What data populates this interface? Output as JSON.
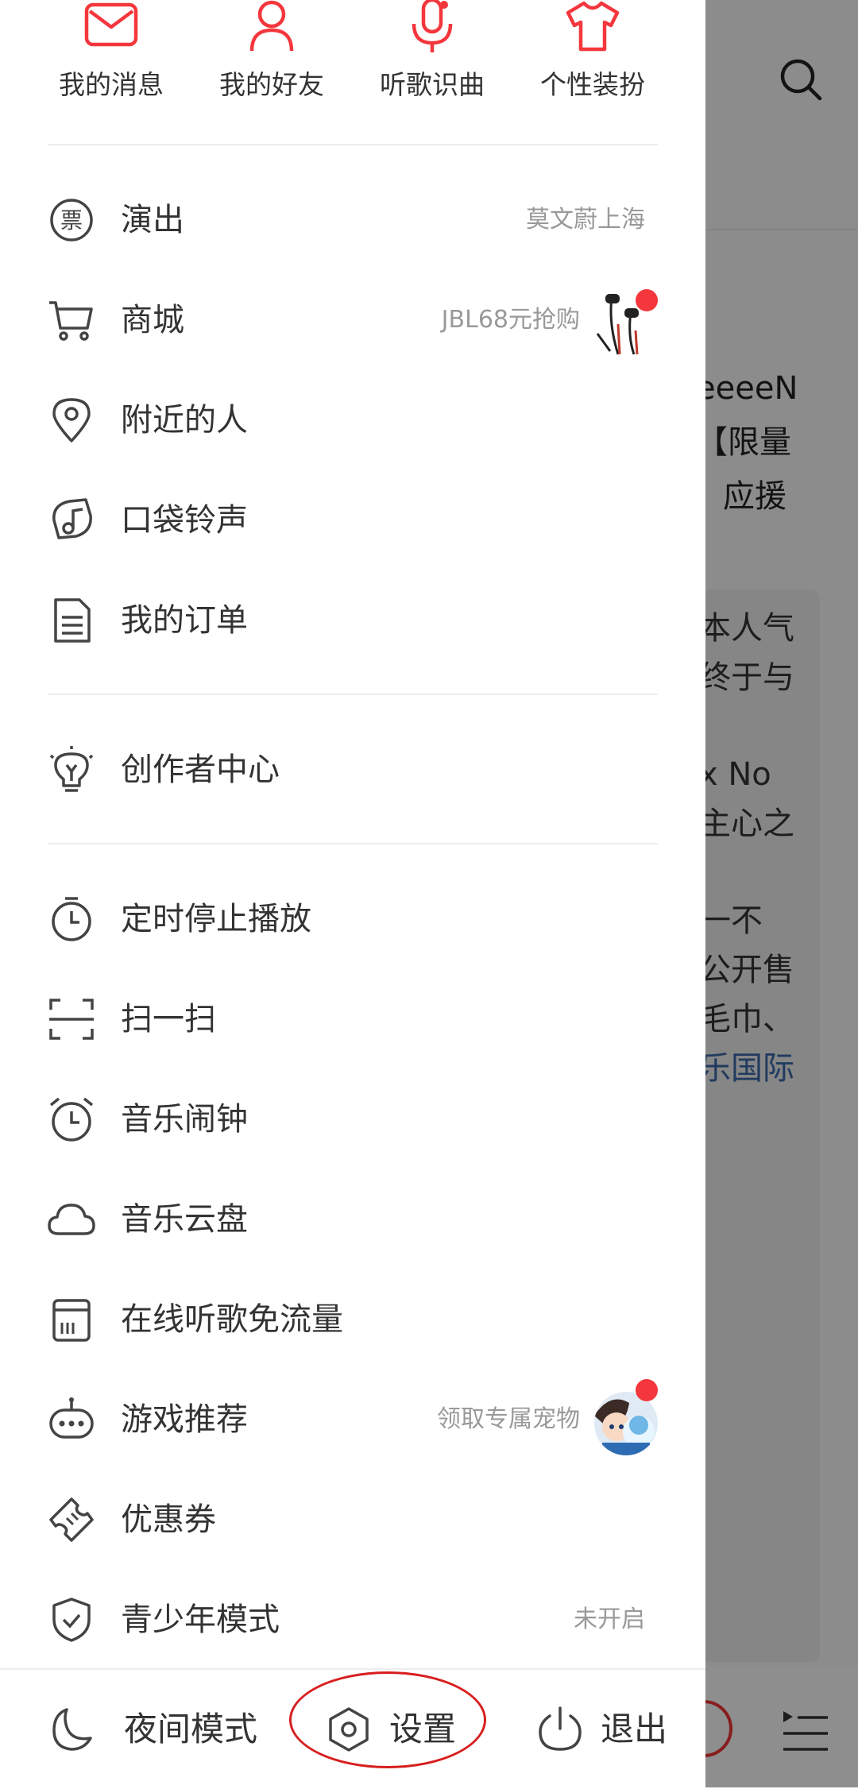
{
  "colors": {
    "accent": "#f4373d",
    "icon": "#444444",
    "text": "#333333",
    "subtext": "#999999"
  },
  "quick_actions": [
    {
      "label": "我的消息",
      "icon": "mail-icon"
    },
    {
      "label": "我的好友",
      "icon": "person-icon"
    },
    {
      "label": "听歌识曲",
      "icon": "microphone-icon"
    },
    {
      "label": "个性装扮",
      "icon": "tshirt-icon"
    }
  ],
  "menu": [
    {
      "label": "演出",
      "sub": "莫文蔚上海",
      "icon": "ticket-icon"
    },
    {
      "label": "商城",
      "sub": "JBL68元抢购",
      "icon": "cart-icon",
      "thumb": "earphones-thumbnail"
    },
    {
      "label": "附近的人",
      "icon": "location-pin-icon"
    },
    {
      "label": "口袋铃声",
      "icon": "ringtone-icon"
    },
    {
      "label": "我的订单",
      "icon": "order-document-icon"
    },
    {
      "label": "创作者中心",
      "icon": "lightbulb-icon"
    },
    {
      "label": "定时停止播放",
      "icon": "timer-icon"
    },
    {
      "label": "扫一扫",
      "icon": "scan-icon"
    },
    {
      "label": "音乐闹钟",
      "icon": "alarm-clock-icon"
    },
    {
      "label": "音乐云盘",
      "icon": "cloud-icon"
    },
    {
      "label": "在线听歌免流量",
      "icon": "sim-card-icon"
    },
    {
      "label": "游戏推荐",
      "sub": "领取专属宠物",
      "icon": "gamepad-icon",
      "thumb": "game-avatar-thumbnail"
    },
    {
      "label": "优惠券",
      "icon": "coupon-icon"
    },
    {
      "label": "青少年模式",
      "sub": "未开启",
      "icon": "shield-check-icon"
    }
  ],
  "bottom_bar": {
    "night_mode": "夜间模式",
    "settings": "设置",
    "logout": "退出"
  },
  "background": {
    "headline": [
      "eeeeN",
      "【限量",
      "应援"
    ],
    "body": [
      "本人气",
      "终于与",
      "",
      "x No",
      "主心之",
      "",
      "一不",
      "公开售",
      "毛巾、",
      "乐国际"
    ]
  }
}
